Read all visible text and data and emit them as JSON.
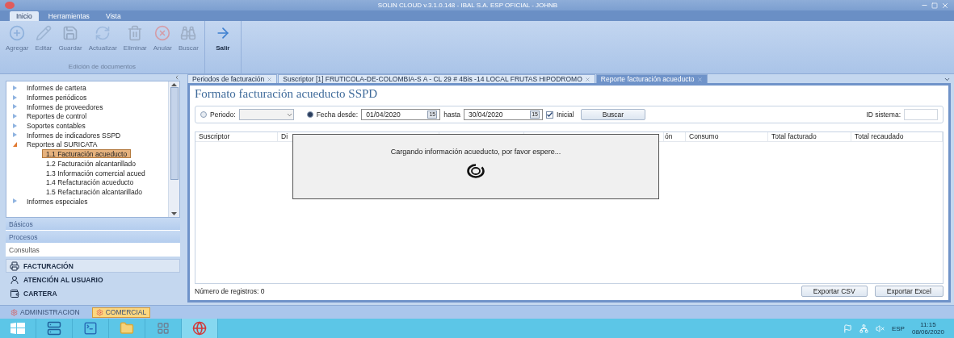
{
  "window": {
    "title": "SOLIN CLOUD v.3.1.0.148 - IBAL S.A. ESP OFICIAL - JOHNB"
  },
  "ribbon": {
    "tabs": [
      {
        "label": "Inicio",
        "selected": true
      },
      {
        "label": "Herramientas",
        "selected": false
      },
      {
        "label": "Vista",
        "selected": false
      }
    ],
    "groups": [
      {
        "label": "Edición de documentos",
        "buttons": [
          {
            "label": "Agregar",
            "kind": "add",
            "disabled": true
          },
          {
            "label": "Editar",
            "kind": "edit",
            "disabled": true
          },
          {
            "label": "Guardar",
            "kind": "save",
            "disabled": true
          },
          {
            "label": "Actualizar",
            "kind": "refresh",
            "disabled": true
          },
          {
            "label": "Eliminar",
            "kind": "delete",
            "disabled": true
          },
          {
            "label": "Anular",
            "kind": "cancel",
            "disabled": true
          },
          {
            "label": "Buscar",
            "kind": "search",
            "disabled": true
          }
        ]
      },
      {
        "buttons": [
          {
            "label": "Salir",
            "kind": "exit",
            "disabled": false
          }
        ]
      }
    ]
  },
  "sidebar": {
    "tree": [
      {
        "label": "Informes de cartera",
        "expanded": false
      },
      {
        "label": "Informes periódicos",
        "expanded": false
      },
      {
        "label": "Informes de proveedores",
        "expanded": false
      },
      {
        "label": "Reportes de control",
        "expanded": false
      },
      {
        "label": "Soportes contables",
        "expanded": false
      },
      {
        "label": "Informes de indicadores SSPD",
        "expanded": false
      },
      {
        "label": "Reportes al SURICATA",
        "expanded": true,
        "children": [
          {
            "label": "1.1 Facturación acueducto",
            "selected": true
          },
          {
            "label": "1.2 Facturación alcantarillado",
            "selected": false
          },
          {
            "label": "1.3 Información comercial acued",
            "selected": false
          },
          {
            "label": "1.4 Refacturación acueducto",
            "selected": false
          },
          {
            "label": "1.5 Refacturación alcantarillado",
            "selected": false
          }
        ]
      },
      {
        "label": "Informes especiales",
        "expanded": false
      }
    ],
    "categories": [
      {
        "label": "Básicos",
        "selected": false
      },
      {
        "label": "Procesos",
        "selected": false
      },
      {
        "label": "Consultas",
        "selected": true
      }
    ],
    "modules": [
      {
        "label": "FACTURACIÓN",
        "kind": "billing",
        "selected": true
      },
      {
        "label": "ATENCIÓN AL USUARIO",
        "kind": "support",
        "selected": false
      },
      {
        "label": "CARTERA",
        "kind": "wallet",
        "selected": false
      }
    ]
  },
  "document_tabs": [
    {
      "label": "Periodos de facturación",
      "selected": false
    },
    {
      "label": "Suscriptor [1] FRUTICOLA-DE-COLOMBIA-S A - CL 29 # 4Bis -14 LOCAL FRUTAS HIPODROMO",
      "selected": false
    },
    {
      "label": "Reporte facturación acueducto",
      "selected": true
    }
  ],
  "report": {
    "title": "Formato facturación acueducto SSPD",
    "period": {
      "label": "Periodo:",
      "selected": false
    },
    "date_range": {
      "label": "Fecha desde:",
      "selected": true,
      "from": {
        "value": "01/04/2020",
        "calendar": "15"
      },
      "to_label": "hasta",
      "to": {
        "value": "30/04/2020",
        "calendar": "15"
      }
    },
    "initial": {
      "label": "Inicial",
      "checked": true
    },
    "search_button": "Buscar",
    "system_id": {
      "label": "ID sistema:"
    },
    "table": {
      "columns": [
        {
          "label": "Suscriptor"
        },
        {
          "label": "Di"
        },
        {},
        {},
        {
          "label": "ón"
        },
        {
          "label": "Consumo"
        },
        {
          "label": "Total facturado"
        },
        {
          "label": "Total recaudado"
        }
      ]
    },
    "record_count": "Número de registros: 0",
    "buttons": [
      "Exportar CSV",
      "Exportar Excel"
    ]
  },
  "loading_dialog": {
    "message": "Cargando información acueducto, por favor espere..."
  },
  "bottom_tabs": [
    {
      "label": "ADMINISTRACION",
      "selected": false
    },
    {
      "label": "COMERCIAL",
      "selected": true
    }
  ],
  "taskbar": {
    "apps": [
      {
        "kind": "start",
        "selected": false
      },
      {
        "kind": "server",
        "selected": false
      },
      {
        "kind": "terminal",
        "selected": false
      },
      {
        "kind": "folder",
        "selected": false
      },
      {
        "kind": "grid",
        "selected": false
      },
      {
        "kind": "browser",
        "selected": true
      }
    ],
    "language": "ESP",
    "time": "11:15",
    "date": "08/06/2020"
  }
}
